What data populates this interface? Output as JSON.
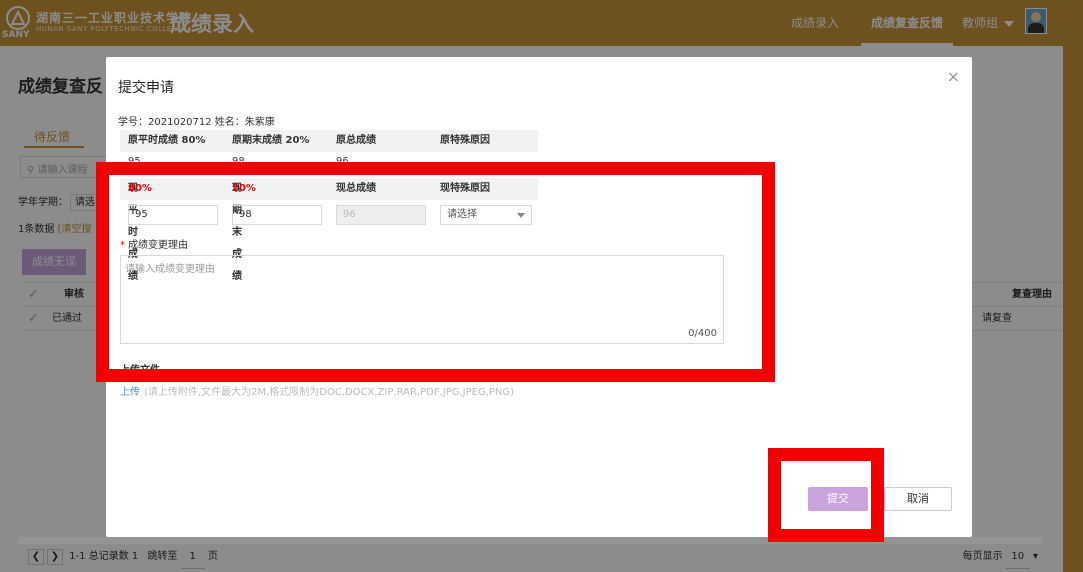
{
  "header": {
    "logo_text": "SANY",
    "school_cn": "湖南三一工业职业技术学院",
    "school_en": "HUNAN SANY POLYTECHNIC COLLEGE",
    "app_title": "成绩录入",
    "nav": [
      {
        "label": "成绩录入",
        "active": false
      },
      {
        "label": "成绩复查反馈",
        "active": true
      }
    ],
    "user": "教师组"
  },
  "page": {
    "title": "成绩复查反",
    "tab_pending": "待反馈",
    "search_placeholder": "请输入课程",
    "term_label": "学年学期：",
    "term_value": "请选",
    "count_text": "1条数据",
    "clear_text": "[清空搜",
    "btn_no_error": "成绩无误",
    "table_header_col2": "审核",
    "table_header_last": "复查理由",
    "row_status": "已通过",
    "row_reason": "请复查",
    "pager_text": "1-1 总记录数 1",
    "jump_label": "跳转至",
    "jump_value": "1",
    "page_unit": "页",
    "per_page_label": "每页显示",
    "per_page_value": "10"
  },
  "modal": {
    "title": "提交申请",
    "close": "×",
    "student": "学号：2021020712   姓名：朱紫康",
    "orig_headers": {
      "usual": "原平时成绩 80%",
      "final": "原期末成绩 20%",
      "total": "原总成绩",
      "reason": "原特殊原因"
    },
    "orig_values": {
      "usual": "95",
      "final": "98",
      "total": "96"
    },
    "new_headers": {
      "usual_prefix": "现平时成绩 ",
      "usual_pct": "80%",
      "final_prefix": "现期末成绩 ",
      "final_pct": "20%",
      "total": "现总成绩",
      "reason": "现特殊原因"
    },
    "new_values": {
      "usual": "95",
      "final": "98",
      "total": "96",
      "reason": "请选择"
    },
    "reason_label": "成绩变更理由",
    "reason_placeholder": "请输入成绩变更理由",
    "reason_counter": "0/400",
    "upload_label": "上传文件",
    "upload_link": "上传",
    "upload_hint": "(请上传附件,文件最大为2M,格式限制为DOC,DOCX,ZIP,RAR,PDF,JPG,JPEG,PNG)",
    "submit": "提交",
    "cancel": "取消"
  },
  "colors": {
    "header": "#c79438",
    "highlight": "#f20000",
    "submit_button": "#c9a3dd",
    "required_red": "#e10000"
  },
  "icons": [
    "sany-logo-icon",
    "caret-down-icon",
    "avatar",
    "close-icon",
    "search-icon",
    "check-icon",
    "chevron-left-icon",
    "chevron-right-icon"
  ]
}
